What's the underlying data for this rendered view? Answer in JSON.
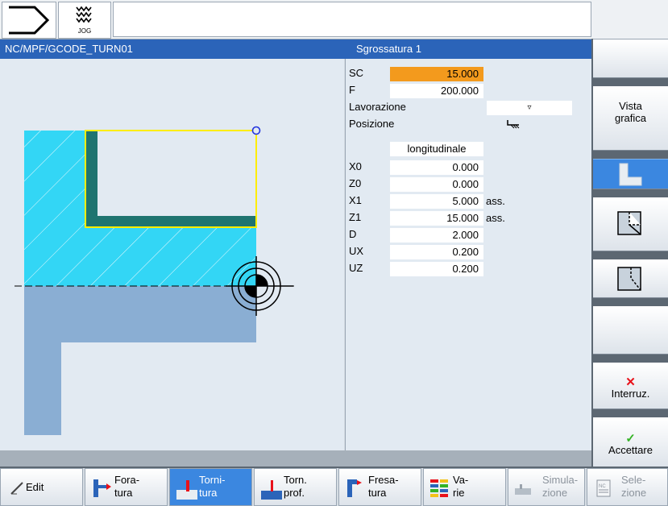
{
  "topbar": {
    "mode_label": "JOG"
  },
  "header": {
    "path": "NC/MPF/GCODE_TURN01",
    "title": "Sgrossatura 1"
  },
  "params": [
    {
      "label": "SC",
      "value": "15.000",
      "unit": "",
      "highlight": true
    },
    {
      "label": "F",
      "value": "200.000",
      "unit": ""
    },
    {
      "label": "Lavorazione",
      "value": "▿",
      "unit": ""
    },
    {
      "label": "Posizione",
      "value": "",
      "unit": ""
    },
    {
      "label": "",
      "value": "longitudinale",
      "unit": ""
    },
    {
      "label": "X0",
      "value": "0.000",
      "unit": ""
    },
    {
      "label": "Z0",
      "value": "0.000",
      "unit": ""
    },
    {
      "label": "X1",
      "value": "5.000",
      "unit": "ass."
    },
    {
      "label": "Z1",
      "value": "15.000",
      "unit": "ass."
    },
    {
      "label": "D",
      "value": "2.000",
      "unit": ""
    },
    {
      "label": "UX",
      "value": "0.200",
      "unit": ""
    },
    {
      "label": "UZ",
      "value": "0.200",
      "unit": ""
    }
  ],
  "right_softkeys": {
    "vista_line1": "Vista",
    "vista_line2": "grafica",
    "interrupt": "Interruz.",
    "accept": "Accettare"
  },
  "bottom_softkeys": {
    "edit": "Edit",
    "foratura_1": "Fora-",
    "foratura_2": "tura",
    "tornitura_1": "Torni-",
    "tornitura_2": "tura",
    "tornprof_1": "Torn.",
    "tornprof_2": "prof.",
    "fresatura_1": "Fresa-",
    "fresatura_2": "tura",
    "varie_1": "Va-",
    "varie_2": "rie",
    "simulazione_1": "Simula-",
    "simulazione_2": "zione",
    "selezione_1": "Sele-",
    "selezione_2": "zione"
  },
  "colors": {
    "header_bg": "#2b64b9",
    "highlight_field": "#f39a1d",
    "stock_cyan": "#33d6f5",
    "part_blue": "#8aaed3",
    "contour_yellow": "#ffee00",
    "finish_teal": "#1f7470",
    "softkey_selected": "#3b87e0"
  }
}
